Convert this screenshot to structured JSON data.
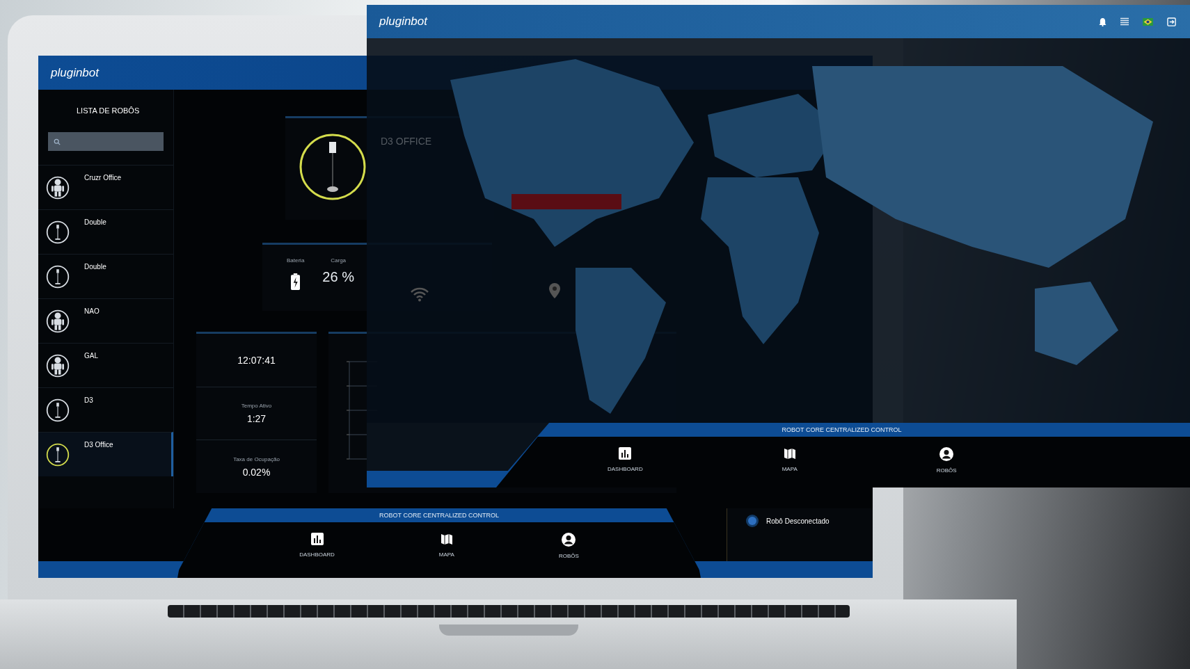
{
  "laptop_app": {
    "logo": "pluginbot",
    "sidebar": {
      "title": "LISTA DE ROBÔS",
      "robots": [
        {
          "name": "Cruzr Office",
          "kind": "humanoid",
          "selected": false
        },
        {
          "name": "Double",
          "kind": "tablet",
          "selected": false
        },
        {
          "name": "Double",
          "kind": "tablet",
          "selected": false
        },
        {
          "name": "NAO",
          "kind": "humanoid",
          "selected": false
        },
        {
          "name": "GAL",
          "kind": "humanoid",
          "selected": false
        },
        {
          "name": "D3",
          "kind": "tablet",
          "selected": false
        },
        {
          "name": "D3 Office",
          "kind": "tablet",
          "selected": true
        }
      ]
    },
    "battery": {
      "label": "Bateria",
      "charge_label": "Carga",
      "value": "26 %"
    },
    "stats": [
      {
        "value": "12:07:41"
      },
      {
        "label": "Tempo Ativo",
        "value": "1:27"
      },
      {
        "label": "Taxa de Ocupação",
        "value": "0.02%"
      }
    ],
    "nav": {
      "title": "ROBOT CORE CENTRALIZED CONTROL",
      "items": [
        {
          "label": "DASHBOARD",
          "kind": "dashboard"
        },
        {
          "label": "MAPA",
          "kind": "map"
        },
        {
          "label": "ROBÔS",
          "kind": "user"
        }
      ]
    },
    "timeline_event": "Robô Desconectado"
  },
  "overlay_app": {
    "logo": "pluginbot",
    "robot_name": "D3 OFFICE",
    "nav": {
      "title": "ROBOT CORE CENTRALIZED CONTROL",
      "items": [
        {
          "label": "DASHBOARD",
          "kind": "dashboard"
        },
        {
          "label": "MAPA",
          "kind": "map"
        },
        {
          "label": "ROBÔS",
          "kind": "user"
        }
      ]
    }
  }
}
